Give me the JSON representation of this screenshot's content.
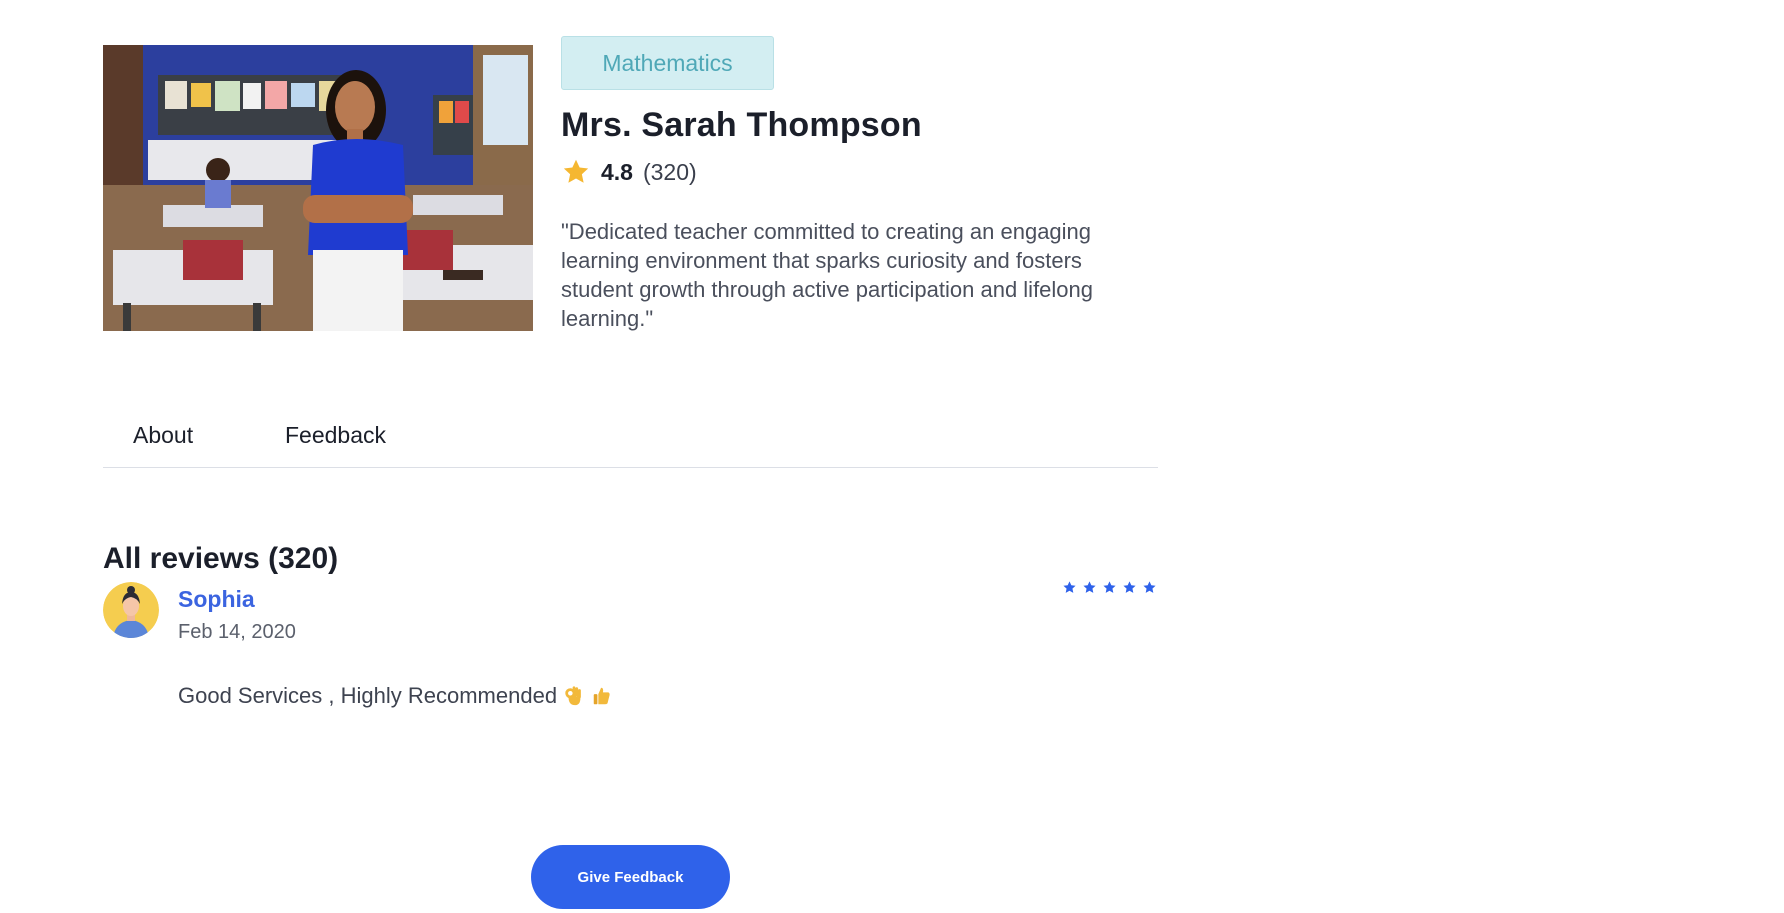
{
  "teacher": {
    "subject": "Mathematics",
    "name": "Mrs. Sarah Thompson",
    "rating": "4.8",
    "rating_count": "(320)",
    "bio": "\"Dedicated teacher committed to creating an engaging learning environment that sparks curiosity and fosters student growth through active participation and lifelong learning.\""
  },
  "tabs": [
    {
      "label": "About"
    },
    {
      "label": "Feedback"
    }
  ],
  "reviews": {
    "title": "All reviews (320)",
    "items": [
      {
        "name": "Sophia",
        "date": "Feb 14, 2020",
        "stars": 5,
        "text": "Good Services , Highly Recommended",
        "emojis": [
          "ok-hand-icon",
          "thumbs-up-icon"
        ]
      }
    ]
  },
  "actions": {
    "give_feedback_label": "Give Feedback"
  },
  "colors": {
    "accent": "#2f62ea",
    "reviewer_name": "#3b64e0",
    "badge_bg": "#d3eef2",
    "badge_text": "#4fa8b7",
    "star_gold": "#f5b731"
  }
}
